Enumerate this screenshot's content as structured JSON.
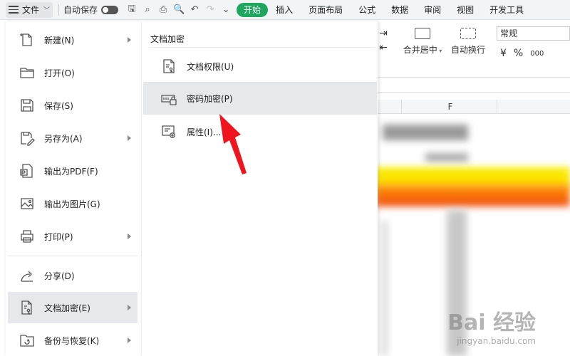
{
  "toolbar": {
    "file_label": "文件",
    "autosave_label": "自动保存",
    "tabs": [
      "开始",
      "插入",
      "页面布局",
      "公式",
      "数据",
      "审阅",
      "视图",
      "开发工具"
    ]
  },
  "ribbon": {
    "merge_center": "合并居中",
    "auto_wrap": "自动换行",
    "number_format": "常规",
    "currency_symbol": "¥",
    "percent_symbol": "%",
    "thousands_symbol": "000"
  },
  "sheet": {
    "column_f": "F"
  },
  "file_menu": {
    "items": [
      {
        "label": "新建(N)",
        "icon": "new-file-icon",
        "submenu": true
      },
      {
        "label": "打开(O)",
        "icon": "folder-open-icon",
        "submenu": false
      },
      {
        "label": "保存(S)",
        "icon": "save-icon",
        "submenu": false
      },
      {
        "label": "另存为(A)",
        "icon": "save-as-icon",
        "submenu": true
      },
      {
        "label": "输出为PDF(F)",
        "icon": "pdf-export-icon",
        "submenu": false
      },
      {
        "label": "输出为图片(G)",
        "icon": "image-export-icon",
        "submenu": false
      },
      {
        "label": "打印(P)",
        "icon": "print-icon",
        "submenu": true
      },
      {
        "label": "分享(D)",
        "icon": "share-icon",
        "submenu": false
      },
      {
        "label": "文档加密(E)",
        "icon": "document-encrypt-icon",
        "submenu": true,
        "active": true
      },
      {
        "label": "备份与恢复(K)",
        "icon": "backup-restore-icon",
        "submenu": true
      }
    ]
  },
  "submenu": {
    "title": "文档加密",
    "items": [
      {
        "label": "文档权限(U)",
        "icon": "document-permission-icon"
      },
      {
        "label": "密码加密(P)",
        "icon": "password-lock-icon",
        "active": true
      },
      {
        "label": "属性(I)...",
        "icon": "properties-gear-icon"
      }
    ]
  },
  "watermark": {
    "brand": "Bai 经验",
    "url": "jingyan.baidu.com"
  },
  "colors": {
    "accent_green": "#1fa760",
    "annotation_red": "#f0141e",
    "active_bg": "#e6e8ec"
  }
}
